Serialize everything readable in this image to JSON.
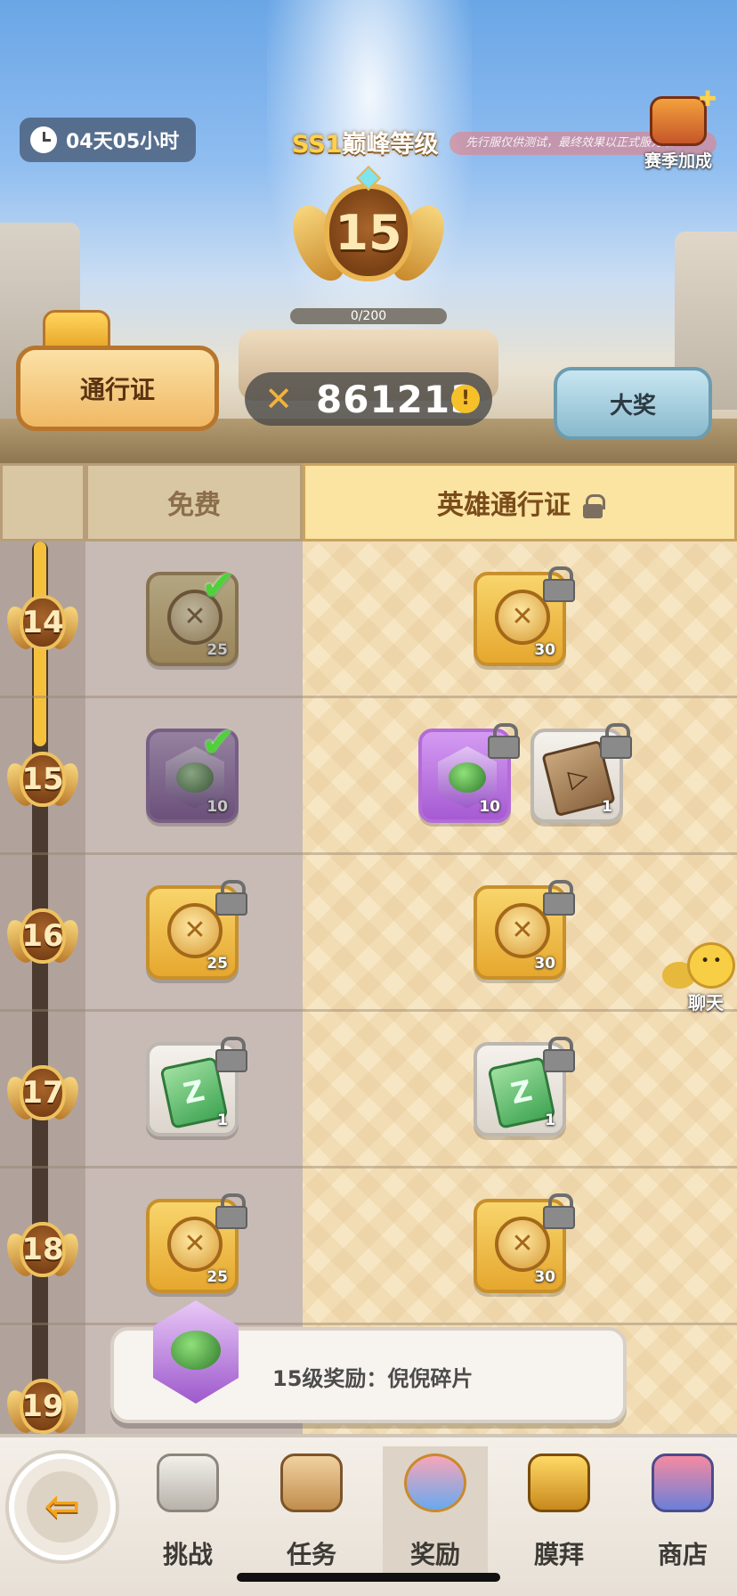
{
  "header": {
    "timer": "04天05小时",
    "season_prefix": "SS1",
    "season_title": "巅峰等级",
    "test_notice": "先行服仅供测试，最终效果以正式服为准",
    "season_bonus_label": "赛季加成",
    "level": "15",
    "xp_progress": "0/200",
    "score": "861213",
    "pass_button": "通行证",
    "grand_prize_button": "大奖"
  },
  "columns": {
    "free": "免费",
    "hero_pass": "英雄通行证"
  },
  "rows": [
    {
      "level": "14",
      "free": {
        "type": "coin",
        "qty": "25",
        "claimed": true
      },
      "hero": [
        {
          "type": "coin",
          "qty": "30"
        }
      ]
    },
    {
      "level": "15",
      "free": {
        "type": "frog-shard",
        "qty": "10",
        "claimed": true
      },
      "hero": [
        {
          "type": "frog-shard",
          "qty": "10"
        },
        {
          "type": "scroll",
          "qty": "1"
        }
      ]
    },
    {
      "level": "16",
      "free": {
        "type": "coin",
        "qty": "25"
      },
      "hero": [
        {
          "type": "coin",
          "qty": "30"
        }
      ]
    },
    {
      "level": "17",
      "free": {
        "type": "ticket",
        "qty": "1"
      },
      "hero": [
        {
          "type": "ticket",
          "qty": "1"
        }
      ]
    },
    {
      "level": "18",
      "free": {
        "type": "coin",
        "qty": "25"
      },
      "hero": [
        {
          "type": "coin",
          "qty": "30"
        }
      ]
    },
    {
      "level": "19"
    }
  ],
  "chat": {
    "label": "聊天"
  },
  "popup": {
    "text": "15级奖励：倪倪碎片"
  },
  "nav": {
    "items": [
      {
        "label": "挑战",
        "icon": "challenge-icon"
      },
      {
        "label": "任务",
        "icon": "task-icon"
      },
      {
        "label": "奖励",
        "icon": "reward-icon",
        "active": true
      },
      {
        "label": "膜拜",
        "icon": "worship-icon"
      },
      {
        "label": "商店",
        "icon": "shop-icon"
      }
    ]
  },
  "colors": {
    "gold": "#f5c03c",
    "hero_column": "#fbe3a2",
    "free_column": "#d9c6a3",
    "check": "#4fd13a"
  }
}
